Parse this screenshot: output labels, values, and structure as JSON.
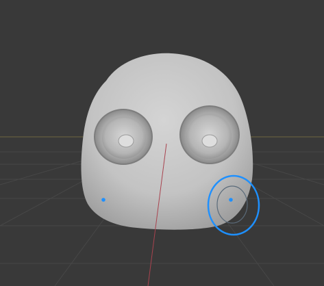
{
  "viewport": {
    "mode": "sculpt",
    "background_color": "#393939",
    "grid_color": "#4a4a4a",
    "horizon_color": "#7a6f45",
    "y_axis_color": "#b04a55",
    "mesh_color": "#c9c9c9",
    "mesh_shadow_color": "#8a8a8a",
    "brush_color": "#1e90ff",
    "symmetry_point_color": "#1e90ff"
  },
  "icons": {
    "brush_cursor": "brush-radius-circle",
    "symmetry_point": "dot"
  }
}
